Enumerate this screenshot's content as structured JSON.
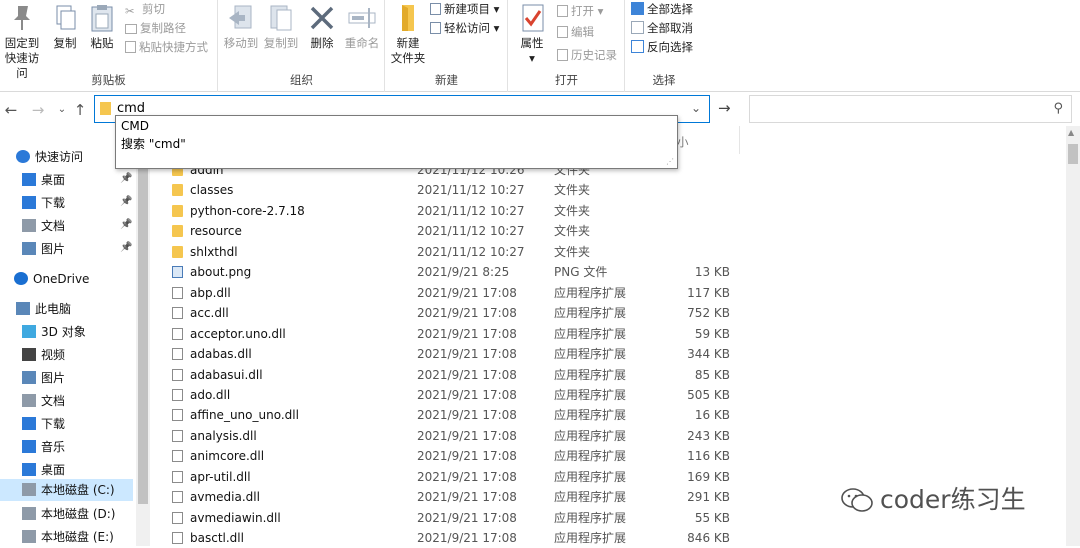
{
  "ribbon": {
    "clipboard": {
      "label": "剪贴板",
      "pin_label_1": "固定到",
      "pin_label_2": "快速访问",
      "copy_label": "复制",
      "paste_label": "粘贴",
      "cut_label": "剪切",
      "copy_path_label": "复制路径",
      "paste_shortcut_label": "粘贴快捷方式"
    },
    "organize": {
      "label": "组织",
      "move_to_label": "移动到",
      "copy_to_label": "复制到",
      "delete_label": "删除",
      "rename_label": "重命名"
    },
    "new": {
      "label": "新建",
      "new_folder_label_1": "新建",
      "new_folder_label_2": "文件夹",
      "new_item_label": "新建项目",
      "easy_access_label": "轻松访问"
    },
    "open": {
      "label": "打开",
      "properties_label": "属性",
      "open_label": "打开",
      "edit_label": "编辑",
      "history_label": "历史记录"
    },
    "select": {
      "label": "选择",
      "select_all_label": "全部选择",
      "select_none_label": "全部取消",
      "invert_label": "反向选择"
    }
  },
  "navigation": {
    "back_icon": "back-arrow-icon",
    "forward_icon": "forward-arrow-icon",
    "recent_icon": "chevron-down-icon",
    "up_icon": "up-arrow-icon"
  },
  "address": {
    "value": "cmd",
    "dropdown_icon": "chevron-down-icon",
    "go_icon": "go-arrow-icon"
  },
  "search": {
    "placeholder": "",
    "icon": "search-icon"
  },
  "autocomplete": {
    "items": [
      "CMD",
      "搜索 \"cmd\""
    ]
  },
  "list_header": {
    "size_partial": "小"
  },
  "sidebar": {
    "items": [
      {
        "label": "快速访问",
        "icon": "star-icon"
      },
      {
        "label": "桌面",
        "icon": "desktop-icon",
        "pinned": true
      },
      {
        "label": "下载",
        "icon": "download-icon",
        "pinned": true
      },
      {
        "label": "文档",
        "icon": "document-icon",
        "pinned": true
      },
      {
        "label": "图片",
        "icon": "picture-icon",
        "pinned": true
      },
      {
        "label": "OneDrive",
        "icon": "cloud-icon"
      },
      {
        "label": "此电脑",
        "icon": "computer-icon"
      },
      {
        "label": "3D 对象",
        "icon": "cube-icon"
      },
      {
        "label": "视频",
        "icon": "video-icon"
      },
      {
        "label": "图片",
        "icon": "picture-icon"
      },
      {
        "label": "文档",
        "icon": "document-icon"
      },
      {
        "label": "下载",
        "icon": "download-icon"
      },
      {
        "label": "音乐",
        "icon": "music-icon"
      },
      {
        "label": "桌面",
        "icon": "desktop-icon"
      },
      {
        "label": "本地磁盘 (C:)",
        "icon": "drive-icon",
        "selected": true
      },
      {
        "label": "本地磁盘 (D:)",
        "icon": "drive-icon"
      },
      {
        "label": "本地磁盘 (E:)",
        "icon": "drive-icon"
      }
    ]
  },
  "files": [
    {
      "name": "addin",
      "date": "2021/11/12 10:26",
      "type": "文件夹",
      "size": "",
      "icon": "folder"
    },
    {
      "name": "classes",
      "date": "2021/11/12 10:27",
      "type": "文件夹",
      "size": "",
      "icon": "folder"
    },
    {
      "name": "python-core-2.7.18",
      "date": "2021/11/12 10:27",
      "type": "文件夹",
      "size": "",
      "icon": "folder"
    },
    {
      "name": "resource",
      "date": "2021/11/12 10:27",
      "type": "文件夹",
      "size": "",
      "icon": "folder"
    },
    {
      "name": "shlxthdl",
      "date": "2021/11/12 10:27",
      "type": "文件夹",
      "size": "",
      "icon": "folder"
    },
    {
      "name": "about.png",
      "date": "2021/9/21 8:25",
      "type": "PNG 文件",
      "size": "13 KB",
      "icon": "image"
    },
    {
      "name": "abp.dll",
      "date": "2021/9/21 17:08",
      "type": "应用程序扩展",
      "size": "117 KB",
      "icon": "dll"
    },
    {
      "name": "acc.dll",
      "date": "2021/9/21 17:08",
      "type": "应用程序扩展",
      "size": "752 KB",
      "icon": "dll"
    },
    {
      "name": "acceptor.uno.dll",
      "date": "2021/9/21 17:08",
      "type": "应用程序扩展",
      "size": "59 KB",
      "icon": "dll"
    },
    {
      "name": "adabas.dll",
      "date": "2021/9/21 17:08",
      "type": "应用程序扩展",
      "size": "344 KB",
      "icon": "dll"
    },
    {
      "name": "adabasui.dll",
      "date": "2021/9/21 17:08",
      "type": "应用程序扩展",
      "size": "85 KB",
      "icon": "dll"
    },
    {
      "name": "ado.dll",
      "date": "2021/9/21 17:08",
      "type": "应用程序扩展",
      "size": "505 KB",
      "icon": "dll"
    },
    {
      "name": "affine_uno_uno.dll",
      "date": "2021/9/21 17:08",
      "type": "应用程序扩展",
      "size": "16 KB",
      "icon": "dll"
    },
    {
      "name": "analysis.dll",
      "date": "2021/9/21 17:08",
      "type": "应用程序扩展",
      "size": "243 KB",
      "icon": "dll"
    },
    {
      "name": "animcore.dll",
      "date": "2021/9/21 17:08",
      "type": "应用程序扩展",
      "size": "116 KB",
      "icon": "dll"
    },
    {
      "name": "apr-util.dll",
      "date": "2021/9/21 17:08",
      "type": "应用程序扩展",
      "size": "169 KB",
      "icon": "dll"
    },
    {
      "name": "avmedia.dll",
      "date": "2021/9/21 17:08",
      "type": "应用程序扩展",
      "size": "291 KB",
      "icon": "dll"
    },
    {
      "name": "avmediawin.dll",
      "date": "2021/9/21 17:08",
      "type": "应用程序扩展",
      "size": "55 KB",
      "icon": "dll"
    },
    {
      "name": "basctl.dll",
      "date": "2021/9/21 17:08",
      "type": "应用程序扩展",
      "size": "846 KB",
      "icon": "dll"
    }
  ],
  "watermark": {
    "text": "coder练习生",
    "icon": "wechat-icon"
  },
  "colors": {
    "address_border": "#0078d7",
    "selection": "#cce8ff",
    "folder": "#f5c64f"
  }
}
